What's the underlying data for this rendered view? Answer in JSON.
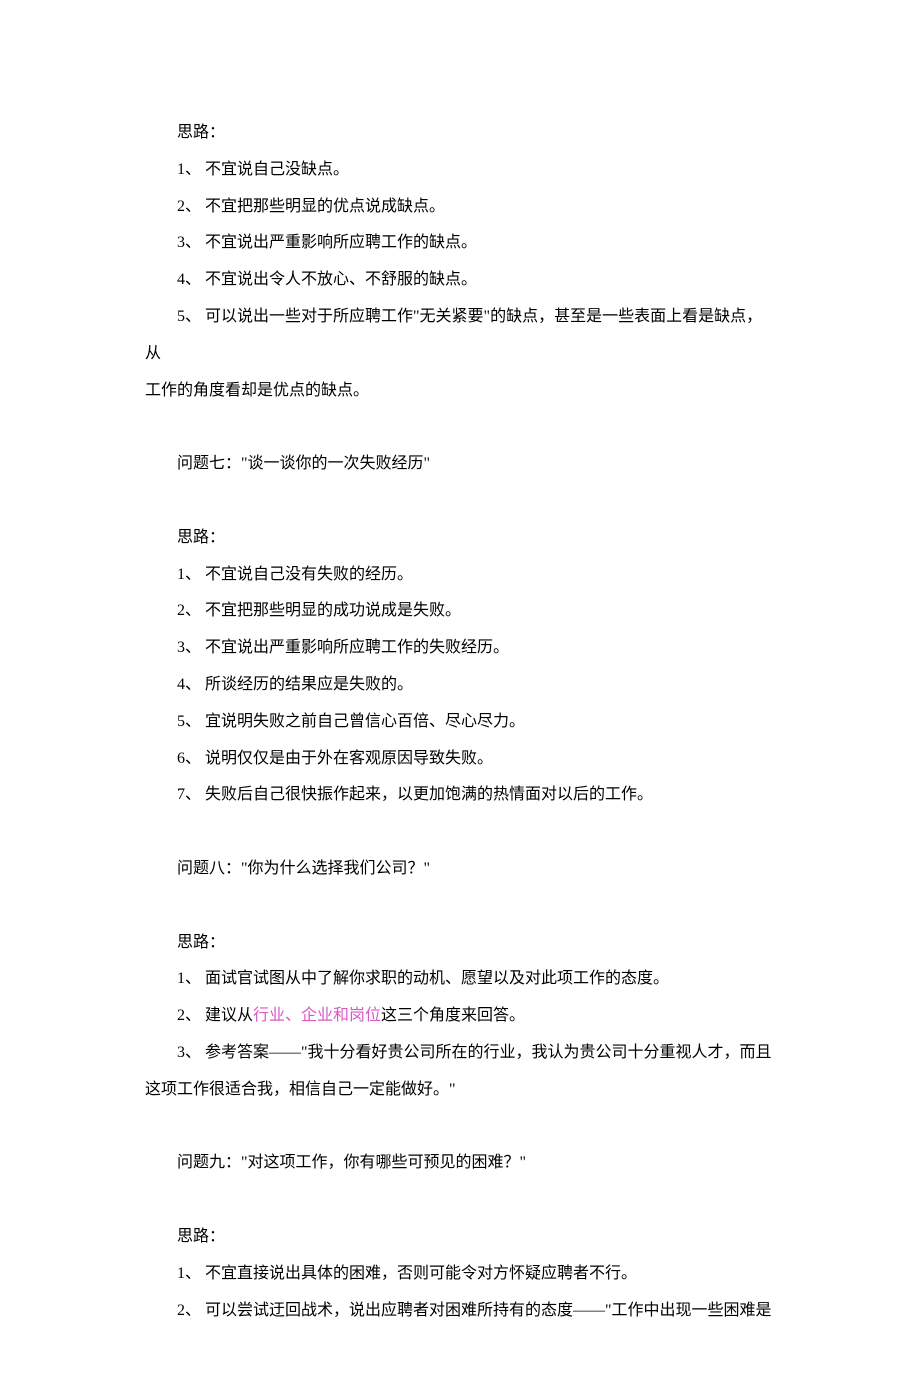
{
  "section6": {
    "heading": "思路：",
    "items": [
      "1、 不宜说自己没缺点。",
      "2、 不宜把那些明显的优点说成缺点。",
      "3、 不宜说出严重影响所应聘工作的缺点。",
      "4、 不宜说出令人不放心、不舒服的缺点。"
    ],
    "item5_prefix": "5、 可以说出一些对于所应聘工作\"无关紧要\"的缺点，甚至是一些表面上看是缺点，从",
    "item5_cont": "工作的角度看却是优点的缺点。"
  },
  "section7": {
    "question": "问题七：\"谈一谈你的一次失败经历\"",
    "heading": "思路：",
    "items": [
      "1、 不宜说自己没有失败的经历。",
      "2、 不宜把那些明显的成功说成是失败。",
      "3、 不宜说出严重影响所应聘工作的失败经历。",
      "4、 所谈经历的结果应是失败的。",
      "5、 宜说明失败之前自己曾信心百倍、尽心尽力。",
      "6、 说明仅仅是由于外在客观原因导致失败。",
      "7、 失败后自己很快振作起来，以更加饱满的热情面对以后的工作。"
    ]
  },
  "section8": {
    "question": "问题八：\"你为什么选择我们公司？\"",
    "heading": "思路：",
    "item1": "1、 面试官试图从中了解你求职的动机、愿望以及对此项工作的态度。",
    "item2_prefix": "2、 建议从",
    "item2_highlight": "行业、企业和岗位",
    "item2_suffix": "这三个角度来回答。",
    "item3_prefix": "3、 参考答案——\"我十分看好贵公司所在的行业，我认为贵公司十分重视人才，而且",
    "item3_cont": "这项工作很适合我，相信自己一定能做好。\""
  },
  "section9": {
    "question": "问题九：\"对这项工作，你有哪些可预见的困难？\"",
    "heading": "思路：",
    "item1": "1、 不宜直接说出具体的困难，否则可能令对方怀疑应聘者不行。",
    "item2": "2、 可以尝试迂回战术，说出应聘者对困难所持有的态度——\"工作中出现一些困难是"
  }
}
